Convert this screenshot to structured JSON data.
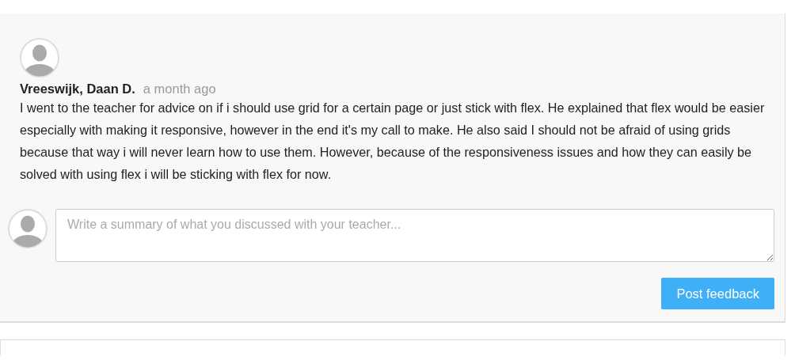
{
  "comment": {
    "author": "Vreeswijk, Daan D.",
    "time": "a month ago",
    "text": "I went to the teacher for advice on if i should use grid for a certain page or just stick with flex. He explained that flex would be easier especially with making it responsive, however in the end it's my call to make. He also said I should not be afraid of using grids because that way i will never learn how to use them. However, because of the responsiveness issues and how they can easily be solved with using flex i will be sticking with flex for now."
  },
  "reply": {
    "placeholder": "Write a summary of what you discussed with your teacher...",
    "button": "Post feedback"
  }
}
